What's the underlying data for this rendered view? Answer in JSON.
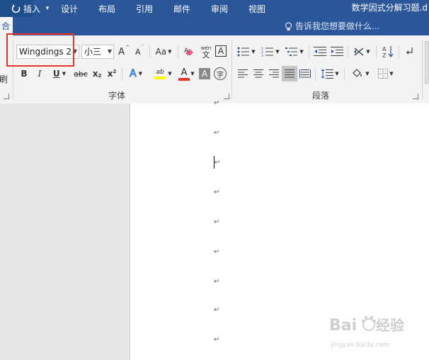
{
  "title_bar": {
    "doc_title": "数学因式分解习题.d",
    "qa_dropdown": "▾"
  },
  "tabs": [
    {
      "label": "合"
    },
    {
      "label": "插入"
    },
    {
      "label": "设计"
    },
    {
      "label": "布局"
    },
    {
      "label": "引用"
    },
    {
      "label": "邮件"
    },
    {
      "label": "审阅"
    },
    {
      "label": "视图"
    }
  ],
  "tell_me": {
    "text": "告诉我您想要做什么..."
  },
  "ribbon": {
    "clipboard_partial": "刷",
    "font": {
      "font_name": "Wingdings 2",
      "font_size": "小三",
      "grow": "A",
      "shrink": "A",
      "change_case": "Aa",
      "pinyin": "wén",
      "border_char": "A",
      "bold": "B",
      "italic": "I",
      "underline": "U",
      "strikethrough": "abc",
      "subscript": "x",
      "subscript_mark": "2",
      "superscript": "x",
      "superscript_mark": "2",
      "text_effects": "A",
      "highlight": "ab",
      "font_color": "A",
      "shading": "A",
      "enclose": "字",
      "group_label": "字体"
    },
    "paragraph": {
      "sort": "A↓",
      "group_label": "段落"
    }
  },
  "document": {
    "paragraph_mark": "↵"
  },
  "watermark": {
    "main": "Bai du 经验",
    "sub": "jingyan.baidu.com"
  },
  "colors": {
    "accent": "#2b579a",
    "highlight_bar": "#ffff00",
    "font_color_bar": "#e8352c",
    "annotation": "#e8352c"
  }
}
